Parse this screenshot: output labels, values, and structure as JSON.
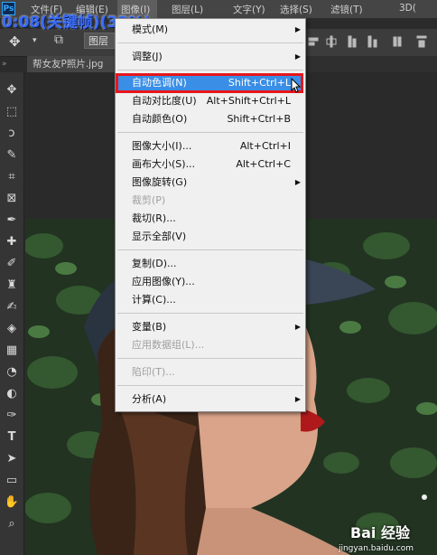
{
  "caption": "0:08(关键帧)(32%)",
  "menubar": {
    "logo": "Ps",
    "items": [
      "文件(F)",
      "编辑(E)",
      "图像(I)",
      "图层(L)",
      "文字(Y)",
      "选择(S)",
      "滤镜(T)",
      "3D("
    ]
  },
  "options": {
    "layer_dropdown": "图层"
  },
  "document": {
    "tab_label": "帮女友P照片.jpg"
  },
  "menu": {
    "mode": "模式(M)",
    "adjust": "调整(J)",
    "auto_tone": "自动色调(N)",
    "auto_tone_sc": "Shift+Ctrl+L",
    "auto_contrast": "自动对比度(U)",
    "auto_contrast_sc": "Alt+Shift+Ctrl+L",
    "auto_color": "自动颜色(O)",
    "auto_color_sc": "Shift+Ctrl+B",
    "image_size": "图像大小(I)...",
    "image_size_sc": "Alt+Ctrl+I",
    "canvas_size": "画布大小(S)...",
    "canvas_size_sc": "Alt+Ctrl+C",
    "rotation": "图像旋转(G)",
    "crop": "裁剪(P)",
    "trim": "裁切(R)...",
    "reveal_all": "显示全部(V)",
    "duplicate": "复制(D)...",
    "apply_image": "应用图像(Y)...",
    "calculations": "计算(C)...",
    "variables": "变量(B)",
    "apply_dataset": "应用数据组(L)...",
    "trap": "陷印(T)...",
    "analysis": "分析(A)"
  },
  "watermark": {
    "brand": "Bai 经验",
    "url": "jingyan.baidu.com"
  }
}
